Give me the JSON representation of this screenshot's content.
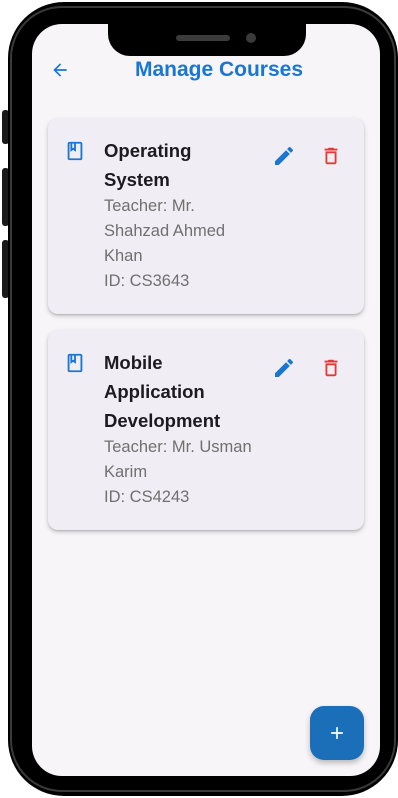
{
  "appbar": {
    "title": "Manage Courses"
  },
  "colors": {
    "accent": "#1976d2",
    "delete": "#e53935",
    "card_bg": "#f1edf4",
    "fab_bg": "#1a6fb8"
  },
  "courses": [
    {
      "name": "Operating System",
      "teacher": "Teacher: Mr. Shahzad Ahmed Khan",
      "id": "ID: CS3643"
    },
    {
      "name": "Mobile Application Development",
      "teacher": "Teacher: Mr. Usman Karim",
      "id": "ID: CS4243"
    }
  ],
  "icons": {
    "back": "arrow-back-icon",
    "course": "book-icon",
    "edit": "pencil-icon",
    "delete": "trash-icon",
    "add": "plus-icon"
  }
}
